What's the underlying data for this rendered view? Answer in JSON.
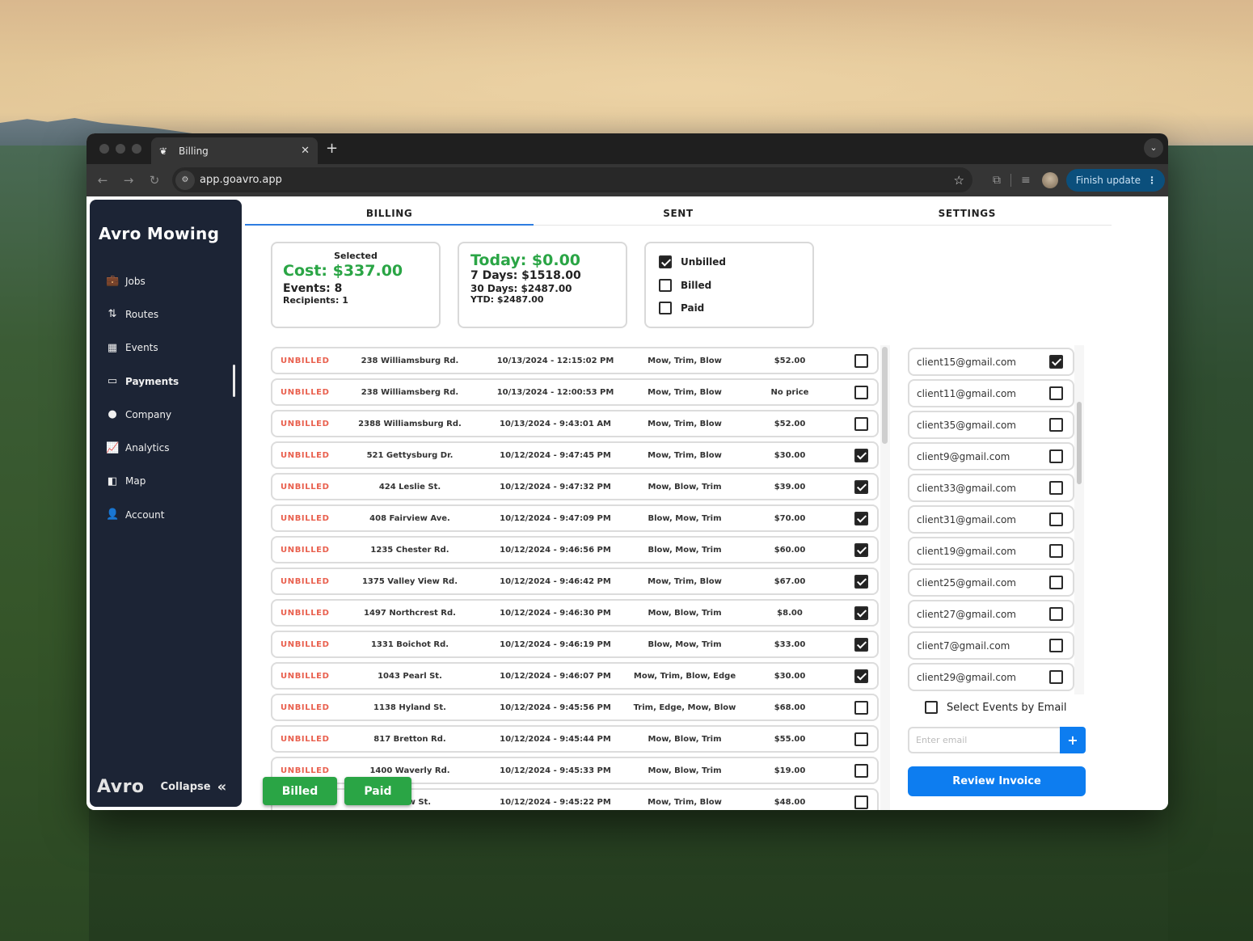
{
  "browser": {
    "tab_title": "Billing",
    "url": "app.goavro.app",
    "finish_update_label": "Finish update",
    "icons": {
      "favicon": "avro-logo-icon",
      "close_tab": "close-icon",
      "new_tab": "plus-icon",
      "tab_menu": "chevron-down-icon",
      "back": "arrow-left-icon",
      "forward": "arrow-right-icon",
      "reload": "reload-icon",
      "site_info": "tune-icon",
      "bookmark": "star-icon",
      "extensions": "puzzle-icon",
      "media": "media-queue-icon",
      "profile": "avatar-icon",
      "more": "kebab-icon"
    }
  },
  "sidebar": {
    "brand": "Avro Mowing",
    "items": [
      {
        "label": "Jobs",
        "icon": "briefcase-icon",
        "glyph": "💼",
        "active": false
      },
      {
        "label": "Routes",
        "icon": "route-icon",
        "glyph": "⇅",
        "active": false
      },
      {
        "label": "Events",
        "icon": "calendar-icon",
        "glyph": "▦",
        "active": false
      },
      {
        "label": "Payments",
        "icon": "credit-card-icon",
        "glyph": "▭",
        "active": true
      },
      {
        "label": "Company",
        "icon": "info-icon",
        "glyph": "●",
        "active": false
      },
      {
        "label": "Analytics",
        "icon": "chart-line-icon",
        "glyph": "📈",
        "active": false
      },
      {
        "label": "Map",
        "icon": "map-icon",
        "glyph": "◧",
        "active": false
      },
      {
        "label": "Account",
        "icon": "user-icon",
        "glyph": "👤",
        "active": false
      }
    ],
    "footer_logo": "Avro",
    "collapse_label": "Collapse",
    "collapse_glyph": "«"
  },
  "tabs": [
    {
      "label": "BILLING",
      "active": true
    },
    {
      "label": "SENT",
      "active": false
    },
    {
      "label": "SETTINGS",
      "active": false
    }
  ],
  "summary": {
    "selected_label": "Selected",
    "cost": "Cost: $337.00",
    "events": "Events: 8",
    "recipients": "Recipients: 1"
  },
  "totals": {
    "today": "Today: $0.00",
    "seven_days": "7 Days: $1518.00",
    "thirty_days": "30 Days: $2487.00",
    "ytd": "YTD: $2487.00"
  },
  "filters": [
    {
      "label": "Unbilled",
      "checked": true
    },
    {
      "label": "Billed",
      "checked": false
    },
    {
      "label": "Paid",
      "checked": false
    }
  ],
  "events": [
    {
      "status": "UNBILLED",
      "address": "238 Williamsburg Rd.",
      "datetime": "10/13/2024 - 12:15:02 PM",
      "services": "Mow, Trim, Blow",
      "price": "$52.00",
      "checked": false
    },
    {
      "status": "UNBILLED",
      "address": "238 Williamsberg Rd.",
      "datetime": "10/13/2024 - 12:00:53 PM",
      "services": "Mow, Trim, Blow",
      "price": "No price",
      "checked": false
    },
    {
      "status": "UNBILLED",
      "address": "2388 Williamsburg Rd.",
      "datetime": "10/13/2024 - 9:43:01 AM",
      "services": "Mow, Trim, Blow",
      "price": "$52.00",
      "checked": false
    },
    {
      "status": "UNBILLED",
      "address": "521 Gettysburg Dr.",
      "datetime": "10/12/2024 - 9:47:45 PM",
      "services": "Mow, Trim, Blow",
      "price": "$30.00",
      "checked": true
    },
    {
      "status": "UNBILLED",
      "address": "424 Leslie St.",
      "datetime": "10/12/2024 - 9:47:32 PM",
      "services": "Mow, Blow, Trim",
      "price": "$39.00",
      "checked": true
    },
    {
      "status": "UNBILLED",
      "address": "408 Fairview Ave.",
      "datetime": "10/12/2024 - 9:47:09 PM",
      "services": "Blow, Mow, Trim",
      "price": "$70.00",
      "checked": true
    },
    {
      "status": "UNBILLED",
      "address": "1235 Chester Rd.",
      "datetime": "10/12/2024 - 9:46:56 PM",
      "services": "Blow, Mow, Trim",
      "price": "$60.00",
      "checked": true
    },
    {
      "status": "UNBILLED",
      "address": "1375 Valley View Rd.",
      "datetime": "10/12/2024 - 9:46:42 PM",
      "services": "Mow, Trim, Blow",
      "price": "$67.00",
      "checked": true
    },
    {
      "status": "UNBILLED",
      "address": "1497 Northcrest Rd.",
      "datetime": "10/12/2024 - 9:46:30 PM",
      "services": "Mow, Blow, Trim",
      "price": "$8.00",
      "checked": true
    },
    {
      "status": "UNBILLED",
      "address": "1331 Boichot Rd.",
      "datetime": "10/12/2024 - 9:46:19 PM",
      "services": "Blow, Mow, Trim",
      "price": "$33.00",
      "checked": true
    },
    {
      "status": "UNBILLED",
      "address": "1043 Pearl St.",
      "datetime": "10/12/2024 - 9:46:07 PM",
      "services": "Mow, Trim, Blow, Edge",
      "price": "$30.00",
      "checked": true
    },
    {
      "status": "UNBILLED",
      "address": "1138 Hyland St.",
      "datetime": "10/12/2024 - 9:45:56 PM",
      "services": "Trim, Edge, Mow, Blow",
      "price": "$68.00",
      "checked": false
    },
    {
      "status": "UNBILLED",
      "address": "817 Bretton Rd.",
      "datetime": "10/12/2024 - 9:45:44 PM",
      "services": "Mow, Blow, Trim",
      "price": "$55.00",
      "checked": false
    },
    {
      "status": "UNBILLED",
      "address": "1400 Waverly Rd.",
      "datetime": "10/12/2024 - 9:45:33 PM",
      "services": "Mow, Blow, Trim",
      "price": "$19.00",
      "checked": false
    },
    {
      "status": "UNBILLED",
      "address": "…llow St.",
      "datetime": "10/12/2024 - 9:45:22 PM",
      "services": "Mow, Trim, Blow",
      "price": "$48.00",
      "checked": false
    }
  ],
  "bulk_actions": {
    "billed_label": "Billed",
    "paid_label": "Paid"
  },
  "emails": [
    {
      "email": "client15@gmail.com",
      "checked": true
    },
    {
      "email": "client11@gmail.com",
      "checked": false
    },
    {
      "email": "client35@gmail.com",
      "checked": false
    },
    {
      "email": "client9@gmail.com",
      "checked": false
    },
    {
      "email": "client33@gmail.com",
      "checked": false
    },
    {
      "email": "client31@gmail.com",
      "checked": false
    },
    {
      "email": "client19@gmail.com",
      "checked": false
    },
    {
      "email": "client25@gmail.com",
      "checked": false
    },
    {
      "email": "client27@gmail.com",
      "checked": false
    },
    {
      "email": "client7@gmail.com",
      "checked": false
    },
    {
      "email": "client29@gmail.com",
      "checked": false
    }
  ],
  "email_tools": {
    "select_by_email_label": "Select Events by Email",
    "select_by_email_checked": false,
    "email_input_value": "",
    "email_input_placeholder": "Enter email",
    "add_glyph": "+",
    "review_invoice_label": "Review Invoice"
  },
  "colors": {
    "accent_blue": "#0d7df0",
    "success_green": "#2aa545",
    "unbilled_red": "#e9604e",
    "sidebar_bg": "#1c2435"
  }
}
